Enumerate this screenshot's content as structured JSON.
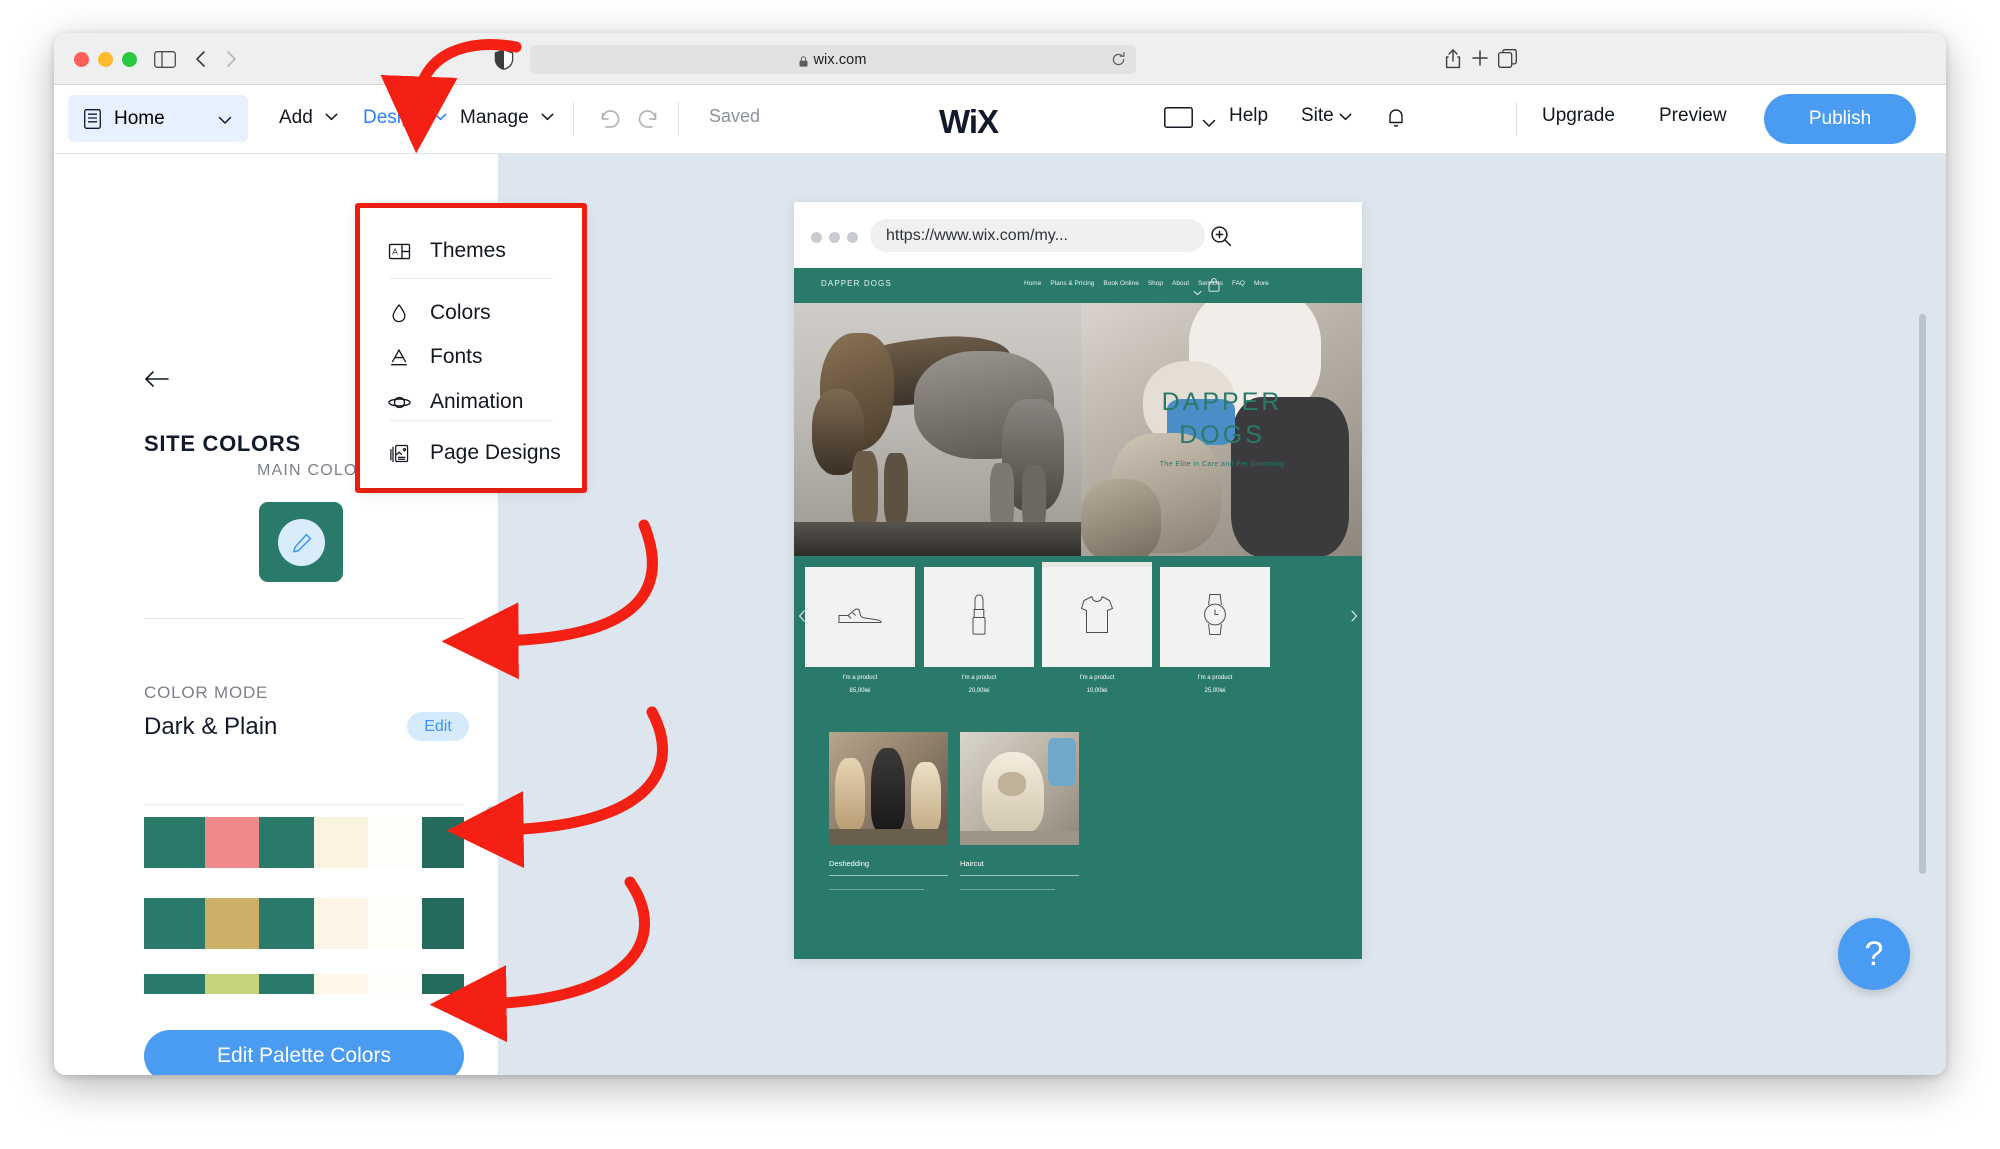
{
  "browser": {
    "address": "wix.com",
    "lock_icon": "lock-icon",
    "reload_icon": "reload-icon",
    "shield_icon": "shield-icon",
    "share_icon": "share-icon",
    "new_tab_icon": "plus-icon",
    "tabs_icon": "tabs-icon",
    "back_icon": "chevron-left-icon",
    "forward_icon": "chevron-right-icon",
    "sidebar_icon": "sidebar-toggle-icon"
  },
  "editor": {
    "home": {
      "label": "Home",
      "icon": "document-icon",
      "chevron": "chevron-down-icon"
    },
    "menus": [
      {
        "label": "Add",
        "active": false
      },
      {
        "label": "Design",
        "active": true
      },
      {
        "label": "Manage",
        "active": false
      }
    ],
    "undo_icon": "undo-icon",
    "redo_icon": "redo-icon",
    "save_status": "Saved",
    "logo": "WiX",
    "viewport_icon": "desktop-monitor-icon",
    "help_label": "Help",
    "site_label": "Site",
    "notifications_icon": "bell-icon",
    "upgrade_label": "Upgrade",
    "preview_label": "Preview",
    "publish_label": "Publish",
    "publish_color": "#4a9cf3",
    "design_accent_color": "#2b7ff5"
  },
  "design_menu": {
    "items": [
      {
        "label": "Themes",
        "icon": "themes-icon"
      },
      {
        "label": "Colors",
        "icon": "droplet-icon"
      },
      {
        "label": "Fonts",
        "icon": "letter-a-icon"
      },
      {
        "label": "Animation",
        "icon": "planet-icon"
      },
      {
        "label": "Page Designs",
        "icon": "page-designs-icon"
      }
    ],
    "highlight_color": "#f32013"
  },
  "left_panel": {
    "back_icon": "back-arrow-icon",
    "title": "SITE COLORS",
    "main_color_label": "MAIN COLOR",
    "main_color_hex": "#2a7a6b",
    "main_color_edit_icon": "pencil-icon",
    "color_mode_label": "COLOR MODE",
    "color_mode_value": "Dark & Plain",
    "color_mode_edit_label": "Edit",
    "edit_palette_label": "Edit Palette Colors",
    "palettes": [
      {
        "colors": [
          "#2a7a6b",
          "#f08a8a",
          "#2a7a6b",
          "#fbf3e0",
          "#fdfdfa",
          "#246b5d"
        ]
      },
      {
        "colors": [
          "#2a7a6b",
          "#cdaf67",
          "#2a7a6b",
          "#fdf5e8",
          "#fffdf7",
          "#246b5d"
        ]
      },
      {
        "colors": [
          "#2a7a6b",
          "#c5d47a",
          "#2a7a6b",
          "#fdf8ea",
          "#fffefa",
          "#246b5d"
        ]
      }
    ]
  },
  "site_preview": {
    "url": "https://www.wix.com/my...",
    "zoom_icon": "zoom-in-icon",
    "brand": "DAPPER DOGS",
    "nav_links": [
      "Home",
      "Plans & Pricing",
      "Book Online",
      "Shop",
      "About",
      "Services",
      "FAQ",
      "More"
    ],
    "nav_chevron_icon": "chevron-down-icon",
    "cart_icon": "shopping-bag-icon",
    "hero": {
      "title_line1": "DAPPER",
      "title_line2": "DOGS",
      "subtitle": "The Elite in Care and Pet Grooming"
    },
    "products": [
      {
        "name": "I'm a product",
        "price": "85,00lei",
        "icon": "shoe-icon"
      },
      {
        "name": "I'm a product",
        "price": "20,00lei",
        "icon": "lipstick-icon"
      },
      {
        "name": "I'm a product",
        "price": "10,00lei",
        "icon": "shirt-icon"
      },
      {
        "name": "I'm a product",
        "price": "25,00lei",
        "icon": "watch-icon"
      }
    ],
    "product_prev_icon": "chevron-left-icon",
    "product_next_icon": "chevron-right-icon",
    "services": [
      {
        "name": "Deshedding"
      },
      {
        "name": "Haircut"
      }
    ],
    "background_color": "#2a7a6b"
  },
  "help_bubble": {
    "label": "?"
  }
}
